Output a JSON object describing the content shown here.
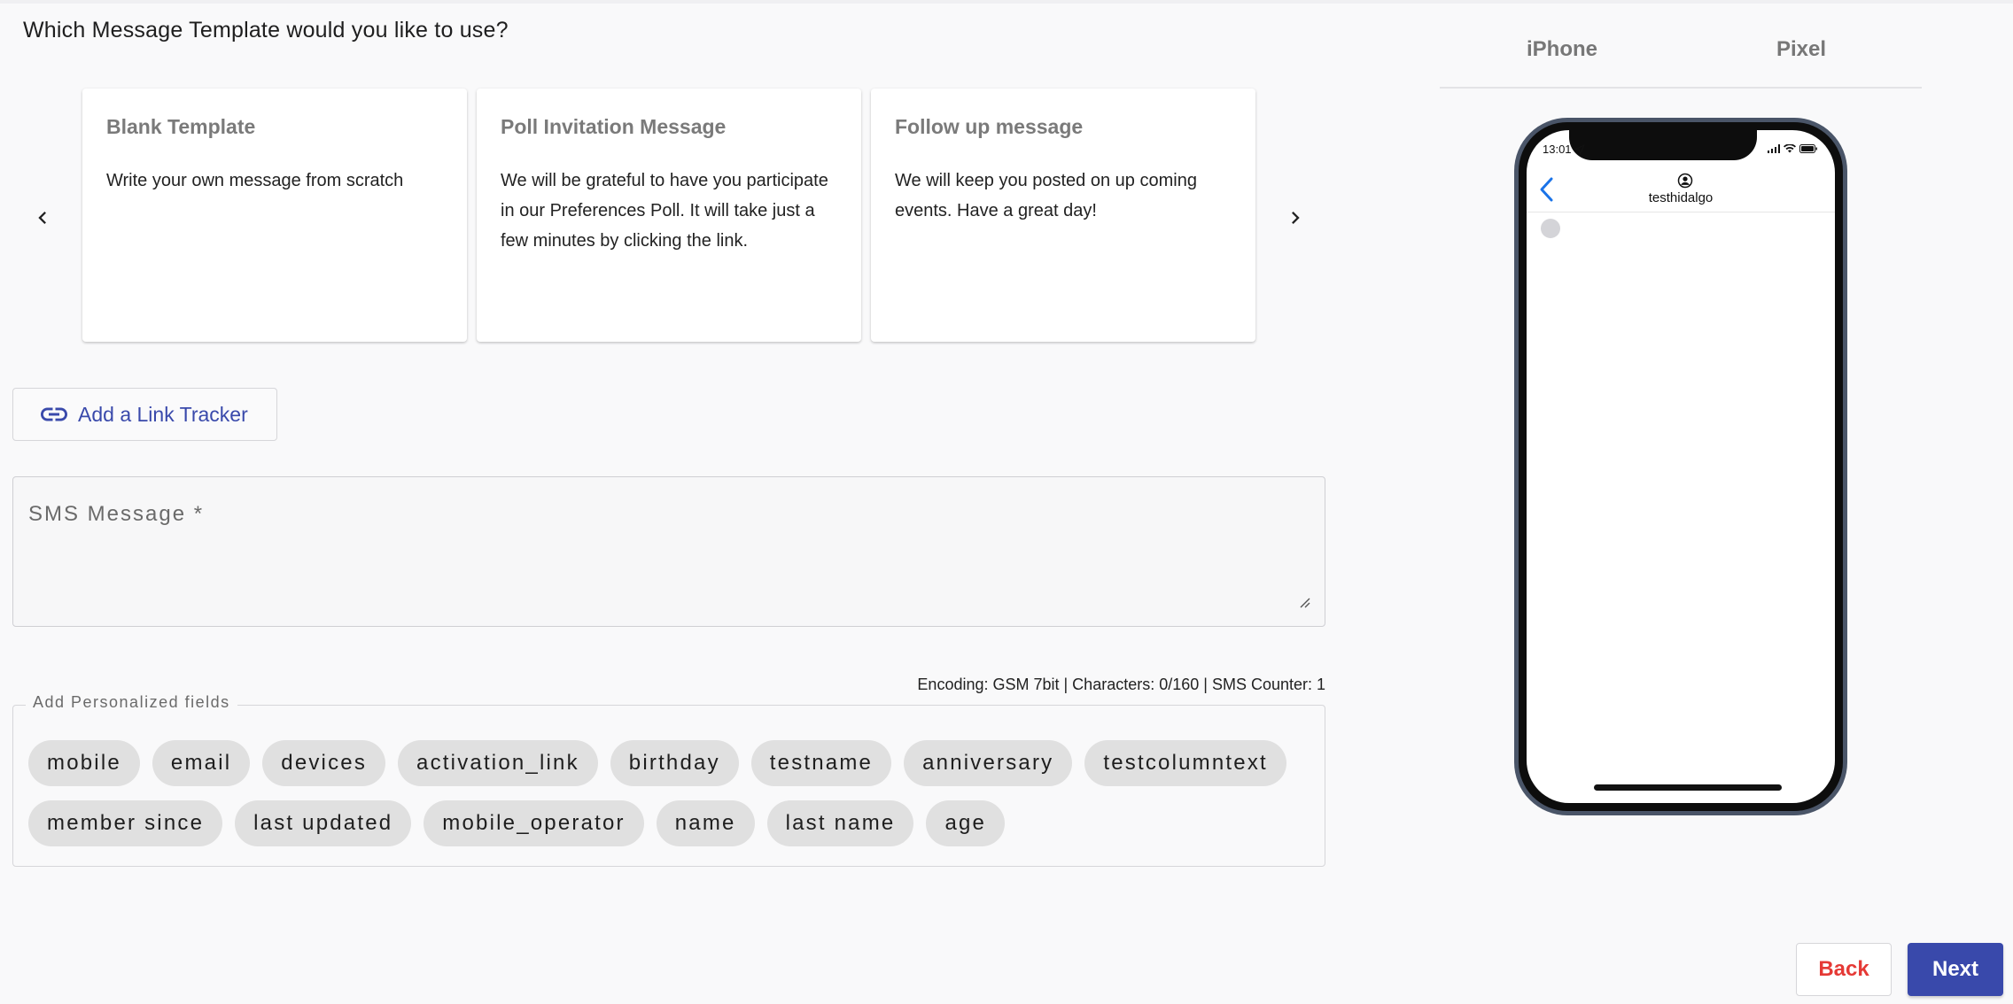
{
  "question": "Which Message Template would you like to use?",
  "templates": [
    {
      "title": "Blank Template",
      "body": "Write your own message from scratch"
    },
    {
      "title": "Poll Invitation Message",
      "body": "We will be grateful to have you participate in our Preferences Poll. It will take just a few minutes by clicking the link."
    },
    {
      "title": "Follow up message",
      "body": "We will keep you posted on up coming events. Have a great day!"
    }
  ],
  "link_tracker": {
    "label": "Add a Link Tracker",
    "icon": "link-icon"
  },
  "sms": {
    "placeholder": "SMS Message *",
    "value": ""
  },
  "encoding_info": "Encoding: GSM 7bit | Characters: 0/160 | SMS Counter: 1",
  "personalized": {
    "legend": "Add Personalized fields",
    "fields": [
      "mobile",
      "email",
      "devices",
      "activation_link",
      "birthday",
      "testname",
      "anniversary",
      "testcolumntext",
      "member since",
      "last updated",
      "mobile_operator",
      "name",
      "last name",
      "age"
    ]
  },
  "device_tabs": [
    "iPhone",
    "Pixel"
  ],
  "phone": {
    "time": "13:01",
    "contact": "testhidalgo"
  },
  "buttons": {
    "back": "Back",
    "next": "Next"
  },
  "colors": {
    "primary": "#3949ab",
    "danger": "#e53935",
    "card_title": "#7a7a7a",
    "chip": "#e0e0e0"
  }
}
